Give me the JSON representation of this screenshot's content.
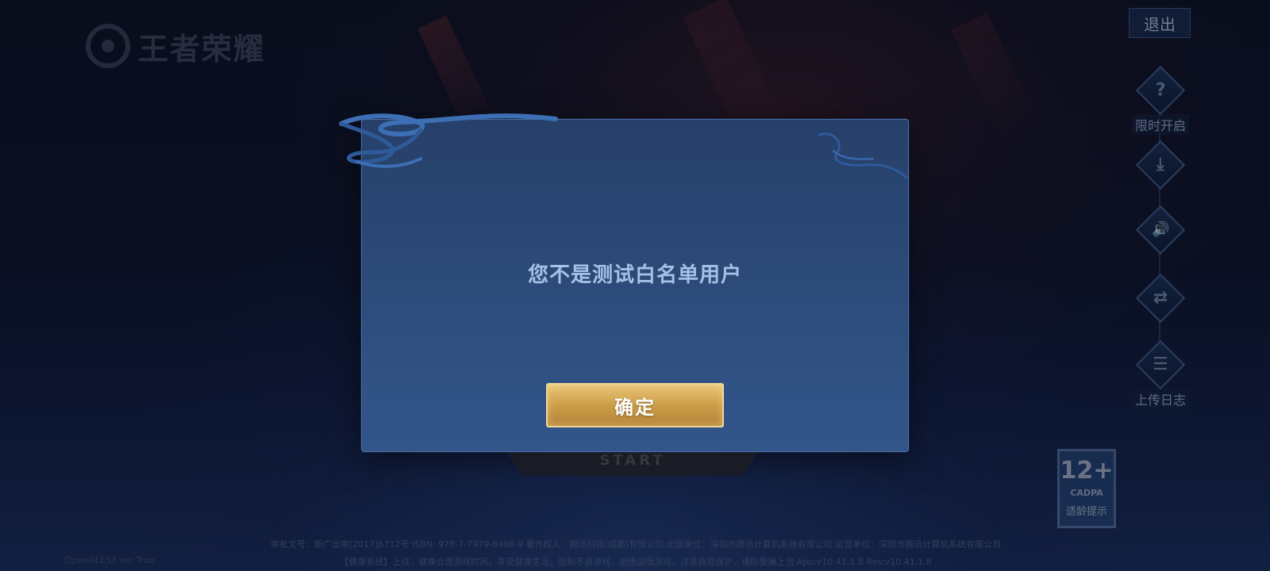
{
  "app": {
    "logo_text": "王者荣耀"
  },
  "header": {
    "exit_label": "退出"
  },
  "sidebar": {
    "items": [
      {
        "icon": "question-icon",
        "glyph": "?",
        "label": "限时开启"
      },
      {
        "icon": "download-icon",
        "glyph": "⤓",
        "label": ""
      },
      {
        "icon": "speaker-icon",
        "glyph": "🔊",
        "label": ""
      },
      {
        "icon": "switch-account-icon",
        "glyph": "⇄",
        "label": ""
      },
      {
        "icon": "log-upload-icon",
        "glyph": "☰",
        "label": "上传日志"
      }
    ]
  },
  "start": {
    "label": "START"
  },
  "age_rating": {
    "number": "12+",
    "org": "CADPA",
    "tip": "适龄提示"
  },
  "dialog": {
    "message": "您不是测试白名单用户",
    "confirm_label": "确定"
  },
  "footer": {
    "line1": "审批文号：新广出审[2017]6712号  ISBN: 978-7-7979-8406-9  著作权人：腾讯科技(成都)有限公司  出版单位：深圳市腾讯计算机系统有限公司  运营单位：深圳市腾讯计算机系统有限公司",
    "line2": "【健康系统】上线：健康合理游戏时间，享受健康生活，抵制不良游戏，拒绝盗版游戏，注意自我保护，谨防受骗上当  App:v10.41.1.8  Res:v10.41.1.8",
    "version_left": "OpenGLES3 ver True"
  },
  "colors": {
    "accent_gold": "#c99a45",
    "dialog_blue": "#2c4a78",
    "message_text": "#a6c0e6"
  }
}
